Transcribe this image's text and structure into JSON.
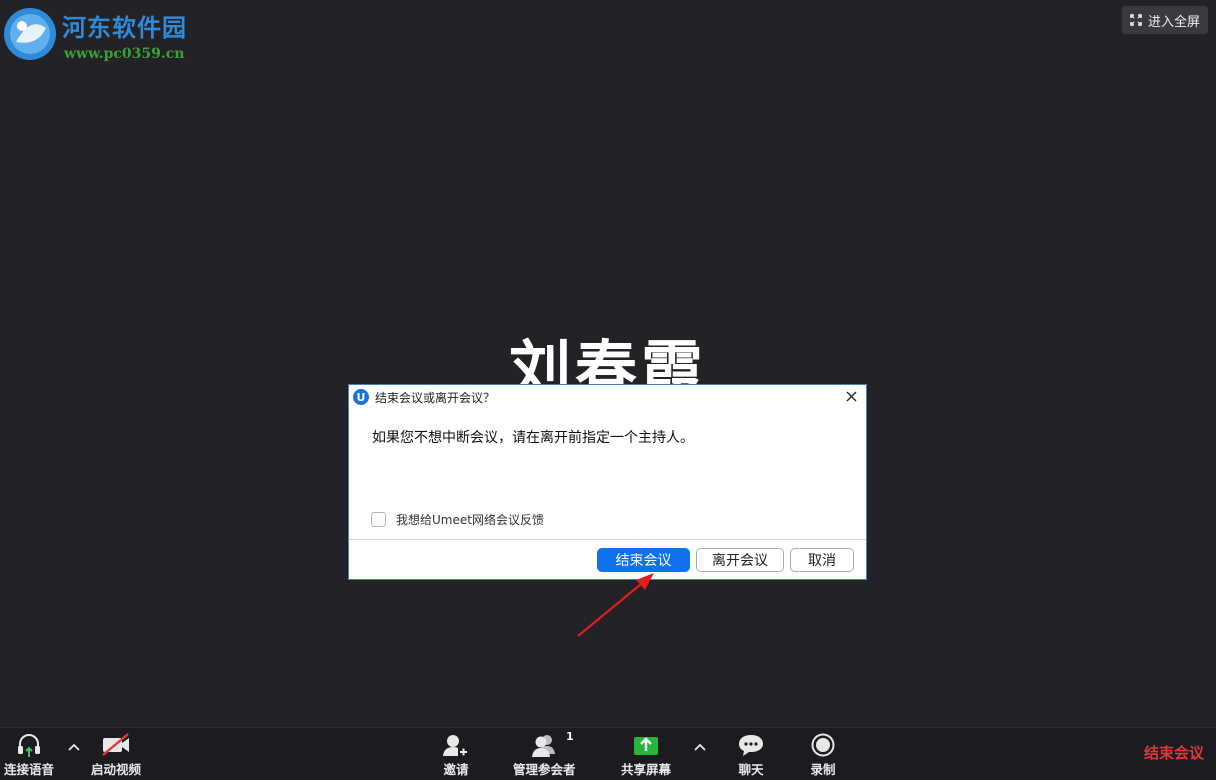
{
  "watermark": {
    "title": "河东软件园",
    "url": "www.pc0359.cn"
  },
  "fullscreen": {
    "label": "进入全屏"
  },
  "participant": {
    "name": "刘春霞"
  },
  "dialog": {
    "title": "结束会议或离开会议？",
    "message": "如果您不想中断会议，请在离开前指定一个主持人。",
    "feedback_checkbox": "我想给Umeet网络会议反馈",
    "feedback_checked": false,
    "buttons": {
      "end": "结束会议",
      "leave": "离开会议",
      "cancel": "取消"
    }
  },
  "toolbar": {
    "audio": "连接语音",
    "video": "启动视频",
    "invite": "邀请",
    "participants": "管理参会者",
    "participants_count": "1",
    "share": "共享屏幕",
    "chat": "聊天",
    "record": "录制",
    "end": "结束会议"
  },
  "colors": {
    "accent": "#0e72ed",
    "end_red": "#e0383b",
    "share_green": "#27b53a",
    "background": "#232226"
  }
}
